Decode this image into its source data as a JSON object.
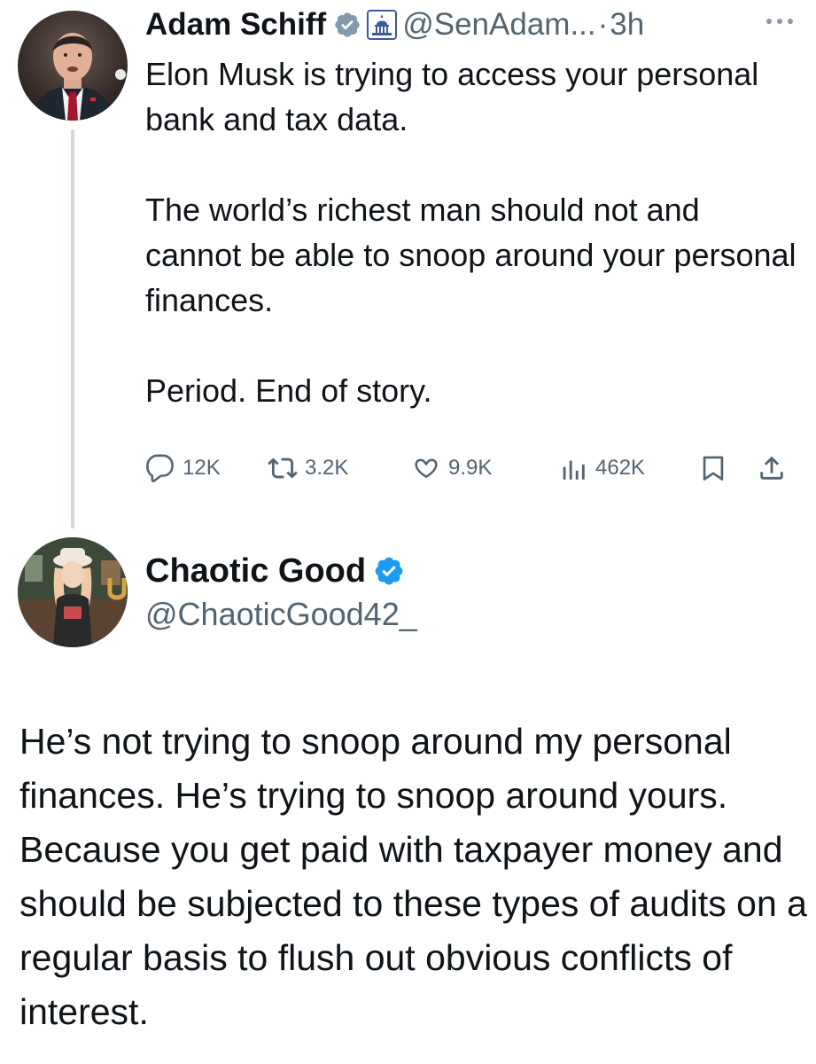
{
  "tweet": {
    "author_name": "Adam Schiff",
    "handle": "@SenAdam...",
    "separator": "·",
    "time": "3h",
    "body": {
      "line1": "Elon Musk is trying to access your personal bank and tax data.",
      "line2": "The world’s richest man should not and cannot be able to snoop around your personal finances.",
      "line3": "Period. End of story."
    },
    "actions": {
      "replies": "12K",
      "reposts": "3.2K",
      "likes": "9.9K",
      "views": "462K"
    },
    "icons": {
      "verified": "verified-badge-grey-icon",
      "affiliation": "capitol-building-icon",
      "more": "more-options-icon",
      "reply": "reply-icon",
      "repost": "repost-icon",
      "like": "heart-icon",
      "views": "views-bar-chart-icon",
      "bookmark": "bookmark-icon",
      "share": "share-icon"
    }
  },
  "reply": {
    "author_name": "Chaotic Good",
    "handle": "@ChaoticGood42_",
    "body": "He’s not trying to snoop around my personal finances.  He’s trying to snoop around yours. Because you get paid with taxpayer money and should be subjected to these types of audits on a regular basis to flush out obvious conflicts of interest.",
    "icons": {
      "verified": "verified-badge-blue-icon"
    }
  },
  "colors": {
    "text": "#0f1419",
    "secondary_text": "#536471",
    "verified_blue": "#1d9bf0",
    "verified_grey": "#829aab",
    "thread_line": "#cfd9de",
    "background": "#ffffff"
  }
}
